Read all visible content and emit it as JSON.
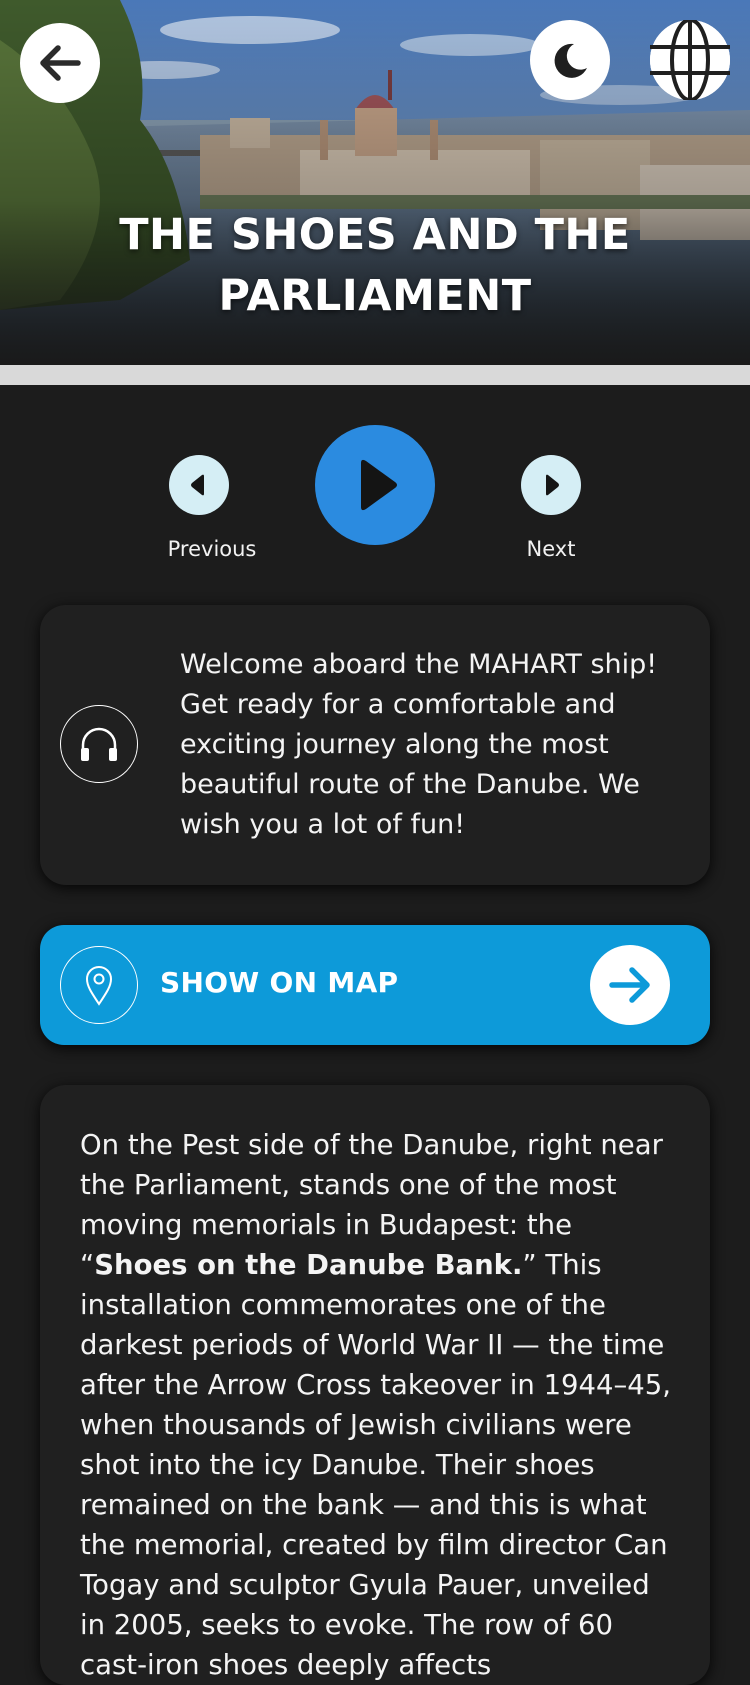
{
  "header": {
    "title_line1": "THE SHOES AND THE",
    "title_line2": "PARLIAMENT",
    "back_icon": "arrow-left-icon",
    "theme_icon": "moon-icon",
    "language_icon": "globe-icon"
  },
  "player": {
    "previous_label": "Previous",
    "next_label": "Next",
    "play_icon": "play-icon",
    "accent": "#2b8be0"
  },
  "welcome": {
    "text": "Welcome aboard the MAHART ship! Get ready for a comfortable and exciting journey along the most beautiful route of the Danube. We wish you a lot of fun!",
    "icon": "headphones-icon"
  },
  "map_button": {
    "label": "SHOW ON MAP",
    "icon": "location-pin-icon",
    "arrow_icon": "arrow-right-icon",
    "color": "#0d9ad9"
  },
  "story": {
    "part1": "On the Pest side of the Danube, right near the Parliament, stands one of the most moving memorials in Budapest: the “",
    "bold": "Shoes on the Danube Bank.",
    "part2": "” This installation commemorates one of the darkest periods of World War II — the time after the Arrow Cross takeover in 1944–45, when thousands of Jewish civilians were shot into the icy Danube. Their shoes remained on the bank — and this is what the memorial, created by film director Can Togay and sculptor Gyula Pauer, unveiled in 2005, seeks to evoke. The row of 60 cast-iron shoes deeply affects"
  }
}
